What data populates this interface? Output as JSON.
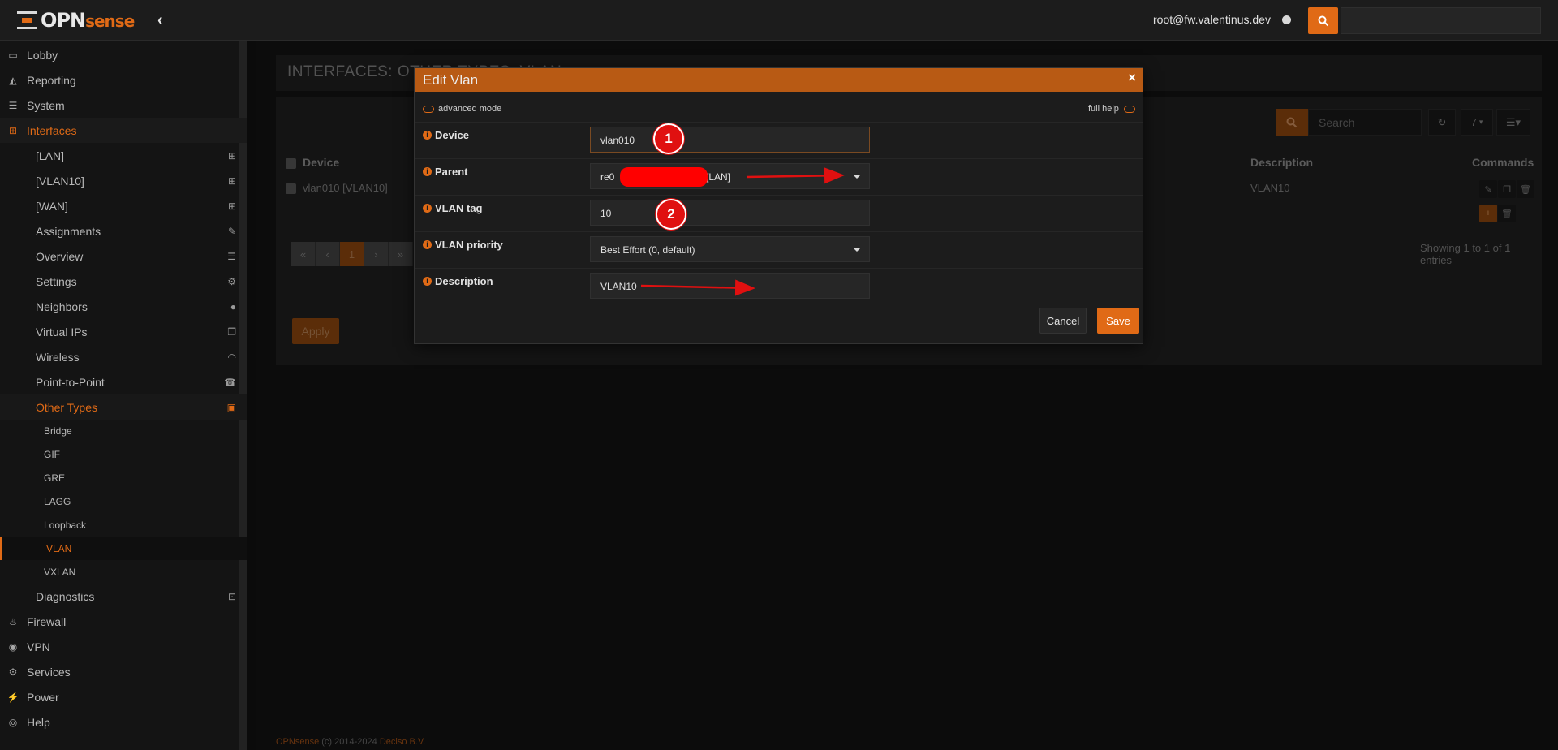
{
  "header": {
    "logo_text": "OPN",
    "logo_text_accent": "sense",
    "user": "root@fw.valentinus.dev",
    "search_placeholder": ""
  },
  "sidebar": {
    "items": [
      {
        "label": "Lobby",
        "icon": "laptop-icon"
      },
      {
        "label": "Reporting",
        "icon": "area-chart-icon"
      },
      {
        "label": "System",
        "icon": "server-icon"
      },
      {
        "label": "Interfaces",
        "icon": "sitemap-icon"
      },
      {
        "label": "Firewall",
        "icon": "fire-icon"
      },
      {
        "label": "VPN",
        "icon": "globe-icon"
      },
      {
        "label": "Services",
        "icon": "cog-icon"
      },
      {
        "label": "Power",
        "icon": "plug-icon"
      },
      {
        "label": "Help",
        "icon": "support-icon"
      }
    ],
    "interfaces_sub": [
      {
        "label": "[LAN]",
        "icon": "sitemap-icon"
      },
      {
        "label": "[VLAN10]",
        "icon": "sitemap-icon"
      },
      {
        "label": "[WAN]",
        "icon": "sitemap-icon"
      },
      {
        "label": "Assignments",
        "icon": "pencil-icon"
      },
      {
        "label": "Overview",
        "icon": "tasks-icon"
      },
      {
        "label": "Settings",
        "icon": "cogs-icon"
      },
      {
        "label": "Neighbors",
        "icon": "users-icon"
      },
      {
        "label": "Virtual IPs",
        "icon": "clone-icon"
      },
      {
        "label": "Wireless",
        "icon": "wifi-icon"
      },
      {
        "label": "Point-to-Point",
        "icon": "tty-icon"
      },
      {
        "label": "Other Types",
        "icon": "archive-icon"
      }
    ],
    "other_types_sub": [
      "Bridge",
      "GIF",
      "GRE",
      "LAGG",
      "Loopback",
      "VLAN",
      "VXLAN"
    ],
    "diagnostics": {
      "label": "Diagnostics",
      "icon": "medkit-icon"
    }
  },
  "page": {
    "title": "INTERFACES: OTHER TYPES: VLAN",
    "search_placeholder": "Search",
    "page_size": "7",
    "columns": {
      "device": "Device",
      "description": "Description",
      "commands": "Commands"
    },
    "rows": [
      {
        "device": "vlan010 [VLAN10]",
        "description": "VLAN10"
      }
    ],
    "pager": [
      "«",
      "‹",
      "1",
      "›",
      "»"
    ],
    "showing": "Showing 1 to 1 of 1 entries",
    "apply_label": "Apply",
    "footer": {
      "brand": "OPNsense",
      "copy": " (c) 2014-2024 ",
      "company": "Deciso B.V."
    }
  },
  "modal": {
    "title": "Edit Vlan",
    "close": "×",
    "advanced_mode": "advanced mode",
    "full_help": "full help",
    "fields": {
      "device": {
        "label": "Device",
        "value": "vlan010"
      },
      "parent": {
        "label": "Parent",
        "value_prefix": "re0",
        "value_suffix": "[LAN]"
      },
      "vlan_tag": {
        "label": "VLAN tag",
        "value": "10"
      },
      "vlan_priority": {
        "label": "VLAN priority",
        "value": "Best Effort (0, default)"
      },
      "description": {
        "label": "Description",
        "value": "VLAN10"
      }
    },
    "cancel_label": "Cancel",
    "save_label": "Save"
  },
  "annotations": {
    "badge_1": "1",
    "badge_2": "2"
  },
  "colors": {
    "accent": "#e06a16",
    "annotation_red": "#e01010"
  }
}
